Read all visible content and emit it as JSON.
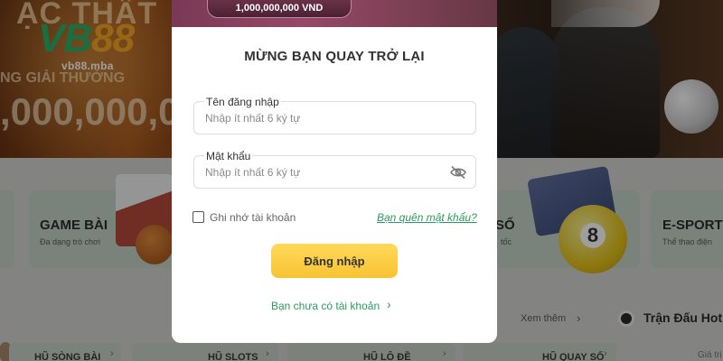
{
  "background": {
    "hero": {
      "headline": "ẠC THẤT",
      "subline": "NG GIẢI THƯỞNG",
      "amount": ",000,000,0",
      "jackpot_amount": "1,000,000,000 VND"
    },
    "logo": {
      "brand_vb": "VB",
      "brand_88": "88",
      "url": "vb88.mba"
    },
    "categories": [
      {
        "title": "GAME BÀI",
        "desc": "Đa dạng trò chơi"
      },
      {
        "title": "SỐ",
        "desc": "tốc"
      },
      {
        "title": "E-SPORTS",
        "desc": "Thể thao điện"
      }
    ],
    "lotto_ball_number": "8",
    "see_more": "Xem thêm",
    "match_title": "Trận Đấu Hot",
    "value_label": "Giá trị",
    "hu_tabs": [
      "HŨ SÒNG BÀI",
      "HŨ SLOTS",
      "HŨ LÔ ĐỀ",
      "HŨ QUAY SỐ"
    ]
  },
  "modal": {
    "title": "MỪNG BẠN QUAY TRỞ LẠI",
    "username": {
      "label": "Tên đăng nhập",
      "placeholder": "Nhập ít nhất 6 ký tự",
      "value": ""
    },
    "password": {
      "label": "Mật khẩu",
      "placeholder": "Nhập ít nhất 6 ký tự",
      "value": ""
    },
    "remember_label": "Ghi nhớ tài khoản",
    "remember_checked": false,
    "forgot_label": "Bạn quên mật khẩu?",
    "login_label": "Đăng nhập",
    "register_label": "Bạn chưa có tài khoản",
    "icons": {
      "password_toggle": "eye-slash-icon",
      "register_arrow": "chevron-right-icon"
    }
  },
  "colors": {
    "accent_green": "#2a9d5c",
    "button_yellow": "#f8c332",
    "logo_green": "#2bb36a",
    "logo_orange": "#f6a623"
  }
}
